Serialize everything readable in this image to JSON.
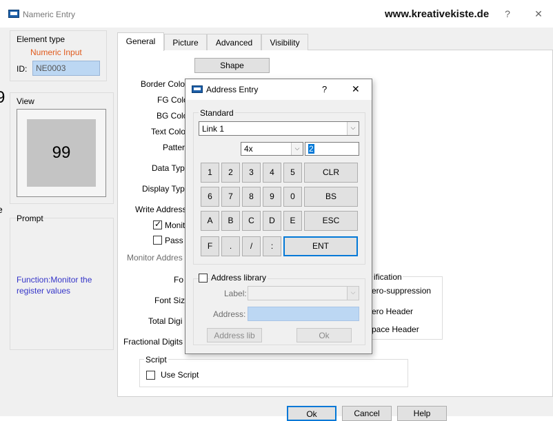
{
  "window": {
    "title": "Nameric Entry",
    "watermark": "www.kreativekiste.de",
    "help_btn": "?",
    "close_btn": "✕"
  },
  "element_type": {
    "label": "Element type",
    "type_value": "Numeric Input",
    "id_label": "ID:",
    "id_value": "NE0003"
  },
  "view": {
    "label": "View",
    "preview_value": "99"
  },
  "prompt": {
    "label": "Prompt",
    "text": "Function:Monitor the register values"
  },
  "tabs": [
    {
      "label": "General"
    },
    {
      "label": "Picture"
    },
    {
      "label": "Advanced"
    },
    {
      "label": "Visibility"
    }
  ],
  "general": {
    "shape_button": "Shape",
    "border_color": "Border Colo",
    "fg_color": "FG Colo",
    "bg_color": "BG Colo",
    "text_color": "Text Colo",
    "pattern": "Patter",
    "data_type": "Data Typ",
    "display_type": "Display Typ",
    "write_address": "Write Address",
    "monitor_check": "Monit",
    "password_check": "Pass",
    "monitor_address": "Monitor Addres",
    "font": "Fo",
    "font_size": "Font Siz",
    "total_digits": "Total Digi",
    "fractional_digits": "Fractional Digits",
    "modification_group": "ification",
    "zero_suppression": "ero-suppression",
    "zero_header": "ero Header",
    "space_header": "pace Header",
    "script_group": "Script",
    "use_script": "Use Script"
  },
  "bottom_buttons": {
    "ok": "Ok",
    "cancel": "Cancel",
    "help": "Help"
  },
  "address_dialog": {
    "title": "Address Entry",
    "help_btn": "?",
    "close_btn": "✕",
    "standard_group": "Standard",
    "link_value": "Link 1",
    "register_type": "4x",
    "address_value": "2",
    "keypad_row1": [
      "1",
      "2",
      "3",
      "4",
      "5",
      "CLR"
    ],
    "keypad_row2": [
      "6",
      "7",
      "8",
      "9",
      "0",
      "BS"
    ],
    "keypad_row3": [
      "A",
      "B",
      "C",
      "D",
      "E",
      "ESC"
    ],
    "keypad_row4": [
      "F",
      ".",
      "/",
      ":",
      "ENT"
    ],
    "address_library_check": "Address library",
    "label_field_label": "Label:",
    "address_field_label": "Address:",
    "address_lib_button": "Address lib",
    "ok_button": "Ok"
  }
}
